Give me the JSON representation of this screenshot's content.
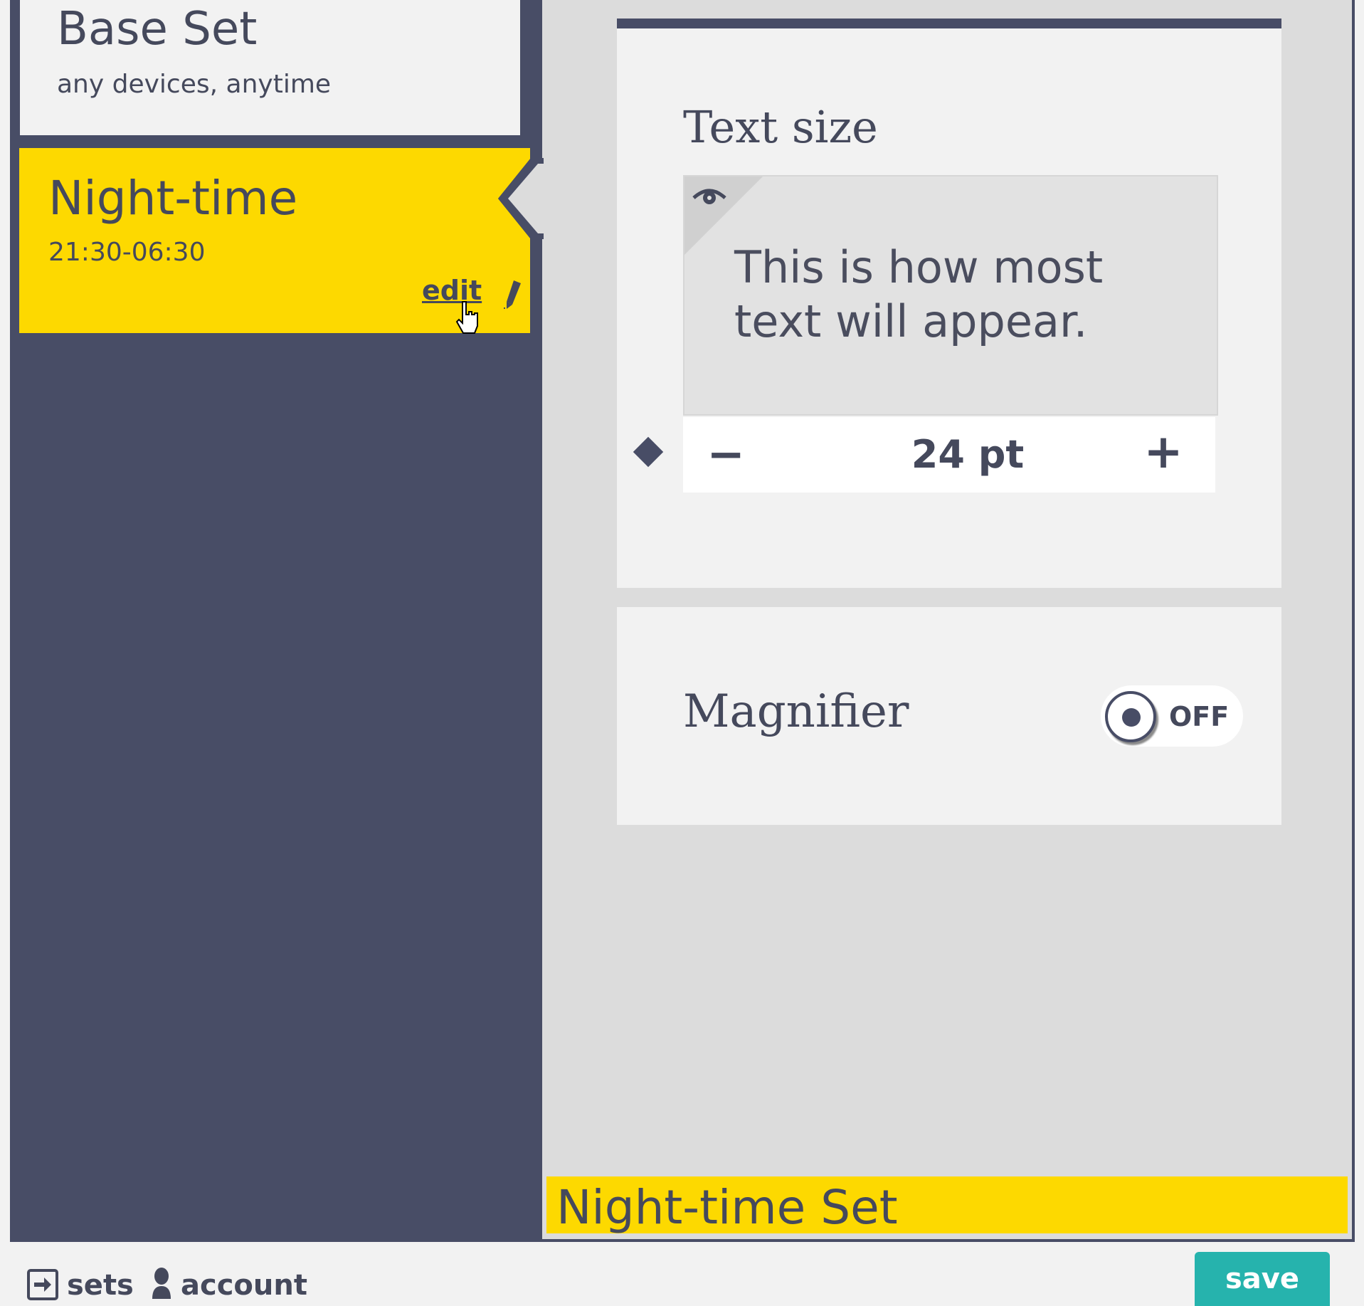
{
  "colors": {
    "navy": "#484d66",
    "yellow": "#fdd900",
    "teal": "#26b3ad",
    "panel_bg": "#f2f2f2",
    "main_bg": "#dcdcdc"
  },
  "sidebar": {
    "sets": [
      {
        "title": "Base Set",
        "subtitle": "any devices, anytime"
      },
      {
        "title": "Night-time",
        "subtitle": "21:30-06:30",
        "edit_label": "edit",
        "selected": true
      }
    ]
  },
  "text_size": {
    "heading": "Text size",
    "preview_text": "This is how most text will appear.",
    "value": "24 pt",
    "minus_label": "−",
    "plus_label": "+",
    "preview_icon": "eye-icon"
  },
  "magnifier": {
    "label": "Magnifier",
    "state": "OFF"
  },
  "current_set": "Night-time Set",
  "bottom_bar": {
    "sets_label": "sets",
    "account_label": "account",
    "save_label": "save"
  }
}
